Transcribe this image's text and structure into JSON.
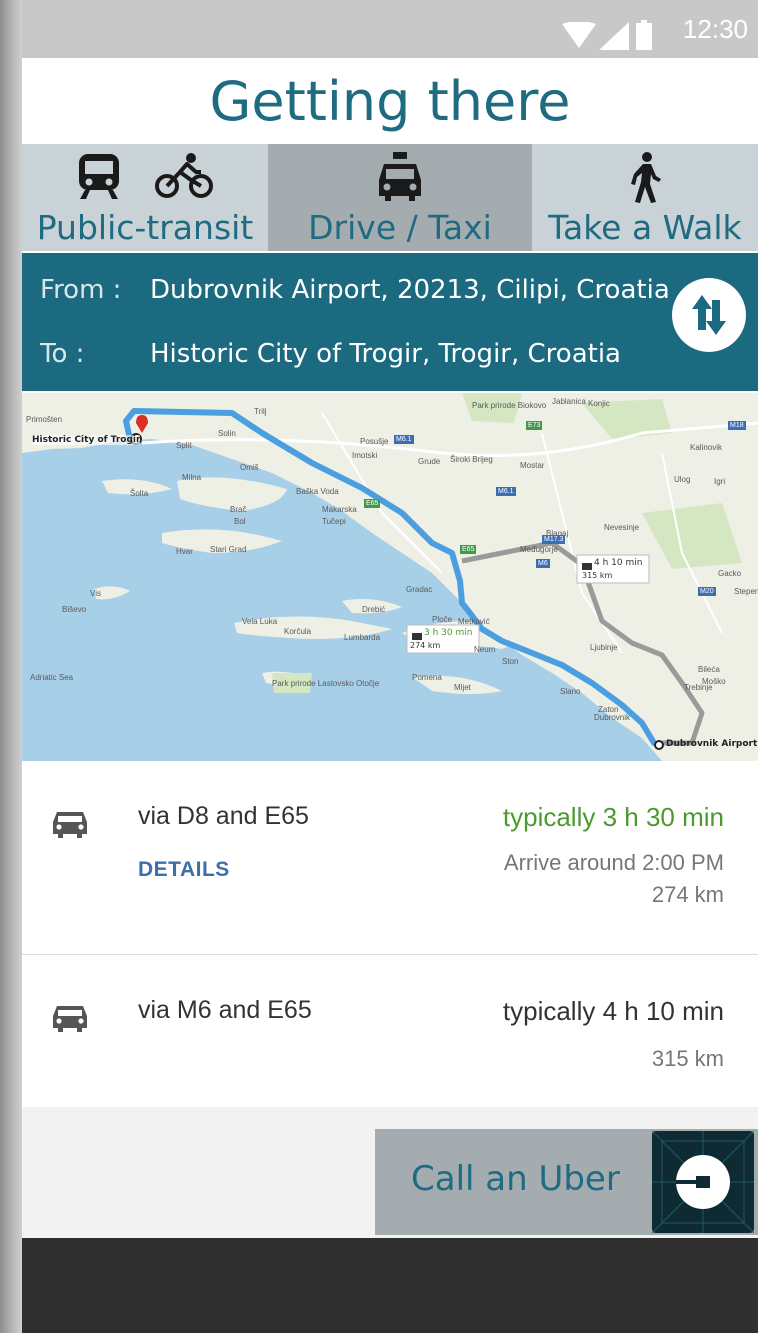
{
  "status_bar": {
    "time": "12:30"
  },
  "page_title": "Getting there",
  "tabs": [
    {
      "label": "Public-transit",
      "icons": [
        "train-icon",
        "bicycle-icon"
      ],
      "selected": false
    },
    {
      "label": "Drive / Taxi",
      "icons": [
        "taxi-icon"
      ],
      "selected": true
    },
    {
      "label": "Take a Walk",
      "icons": [
        "walking-person-icon"
      ],
      "selected": false
    }
  ],
  "route": {
    "from_label": "From :",
    "from_value": "Dubrovnik Airport, 20213, Cilipi, Croatia",
    "to_label": "To     :",
    "to_value": "Historic City of Trogir, Trogir, Croatia"
  },
  "map": {
    "origin_label": "Historic City of Trogir",
    "destination_label": "Dubrovnik Airport",
    "route_1_time": "3 h 30 min",
    "route_1_distance": "274 km",
    "route_2_time": "4 h 10 min",
    "route_2_distance": "315 km",
    "place_labels": [
      "Primošten",
      "Trilj",
      "Solin",
      "Split",
      "Omiš",
      "Šolta",
      "Milna",
      "Brač",
      "Bol",
      "Makarska",
      "Tučepi",
      "Baška Voda",
      "Imotski",
      "Posušje",
      "Grude",
      "Široki Brijeg",
      "Mostar",
      "Jablanica",
      "Konjic",
      "Kalinovik",
      "Ulog",
      "Igri",
      "Nevesinje",
      "Blagaj",
      "Međugorje",
      "Gacko",
      "Stepen",
      "Hvar",
      "Stari Grad",
      "Vis",
      "Biševo",
      "Vela Luka",
      "Korčula",
      "Lumbarda",
      "Drebić",
      "Gradac",
      "Ploče",
      "Metković",
      "Neum",
      "Ljubinje",
      "Bileća",
      "Trebinje",
      "Moško",
      "Ston",
      "Slano",
      "Pomena",
      "Mljet",
      "Zaton",
      "Dubrovnik",
      "Park prirode Biokovo",
      "Park prirode Lastovsko Otočje",
      "Adriatic Sea"
    ],
    "road_labels": [
      "M6.1",
      "E73",
      "M6",
      "M17.3",
      "E65",
      "M20",
      "M18",
      "M6.1",
      "E65"
    ],
    "colors": {
      "sea": "#a8cfe8",
      "land": "#eef0e6",
      "route_primary": "#4b9fe0",
      "route_alt": "#9a9a9a"
    }
  },
  "routes": [
    {
      "via": "via D8 and E65",
      "details": "DETAILS",
      "duration": "typically 3 h 30 min",
      "arrive": "Arrive around 2:00 PM",
      "distance": "274 km",
      "duration_color": "#4a9a2e"
    },
    {
      "via": "via M6 and E65",
      "duration": "typically 4 h 10 min",
      "distance": "315 km",
      "duration_color": "#333333"
    }
  ],
  "uber": {
    "label": "Call an Uber"
  },
  "colors": {
    "accent": "#1e6b82",
    "panel": "#1b6a80",
    "tab_selected": "#a4acb0",
    "tab": "#c9d2d7"
  }
}
